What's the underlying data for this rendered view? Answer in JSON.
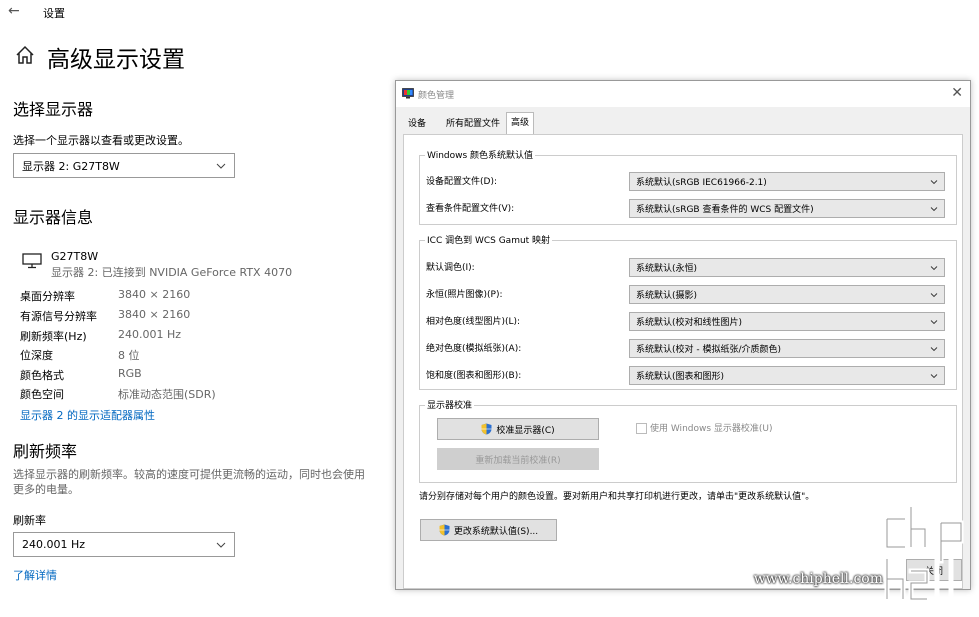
{
  "settings": {
    "app_title": "设置",
    "page_title": "高级显示设置",
    "select_display": {
      "heading": "选择显示器",
      "desc": "选择一个显示器以查看或更改设置。",
      "selected": "显示器 2: G27T8W"
    },
    "display_info": {
      "heading": "显示器信息",
      "monitor_name": "G27T8W",
      "monitor_desc": "显示器 2: 已连接到 NVIDIA GeForce RTX 4070",
      "rows": [
        {
          "k": "桌面分辨率",
          "v": "3840 × 2160"
        },
        {
          "k": "有源信号分辨率",
          "v": "3840 × 2160"
        },
        {
          "k": "刷新频率(Hz)",
          "v": "240.001 Hz"
        },
        {
          "k": "位深度",
          "v": "8 位"
        },
        {
          "k": "颜色格式",
          "v": "RGB"
        },
        {
          "k": "颜色空间",
          "v": "标准动态范围(SDR)"
        }
      ],
      "adapter_link": "显示器 2 的显示适配器属性"
    },
    "refresh": {
      "heading": "刷新频率",
      "desc_line1": "选择显示器的刷新频率。较高的速度可提供更流畅的运动，同时也会使用",
      "desc_line2": "更多的电量。",
      "label": "刷新率",
      "selected": "240.001 Hz",
      "learn_more": "了解详情"
    }
  },
  "dialog": {
    "title": "颜色管理",
    "tabs": [
      "设备",
      "所有配置文件",
      "高级"
    ],
    "windows_defaults": {
      "title": "Windows 颜色系统默认值",
      "device_profile": {
        "label": "设备配置文件(D):",
        "value": "系统默认(sRGB IEC61966-2.1)"
      },
      "viewing_profile": {
        "label": "查看条件配置文件(V):",
        "value": "系统默认(sRGB 查看条件的 WCS 配置文件)"
      }
    },
    "gamut_mapping": {
      "title": "ICC 调色到 WCS Gamut 映射",
      "rows": [
        {
          "label": "默认调色(I):",
          "value": "系统默认(永恒)"
        },
        {
          "label": "永恒(照片图像)(P):",
          "value": "系统默认(摄影)"
        },
        {
          "label": "相对色度(线型图片)(L):",
          "value": "系统默认(校对和线性图片)"
        },
        {
          "label": "绝对色度(模拟纸张)(A):",
          "value": "系统默认(校对 - 模拟纸张/介质颜色)"
        },
        {
          "label": "饱和度(图表和图形)(B):",
          "value": "系统默认(图表和图形)"
        }
      ]
    },
    "calibration": {
      "title": "显示器校准",
      "calibrate_btn": "校准显示器(C)",
      "reload_btn": "重新加载当前校准(R)",
      "use_windows_cal": "使用 Windows 显示器校准(U)"
    },
    "note": "请分别存储对每个用户的颜色设置。要对新用户和共享打印机进行更改，请单击\"更改系统默认值\"。",
    "change_defaults_btn": "更改系统默认值(S)...",
    "close_btn_partial": "关闭"
  },
  "watermark": {
    "url": "www.chiphell.com"
  }
}
